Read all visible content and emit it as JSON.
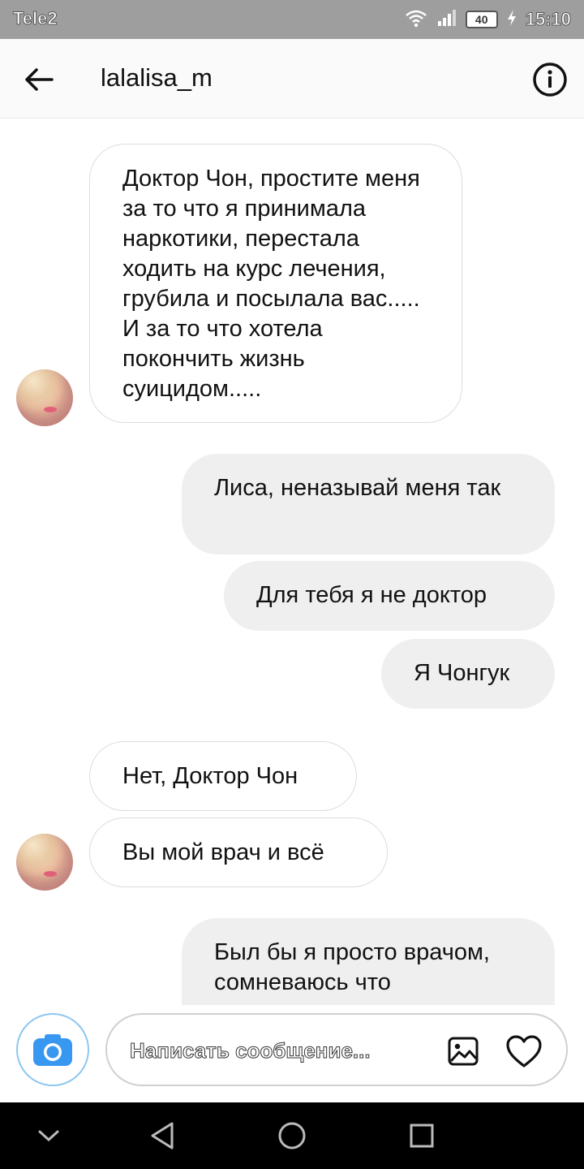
{
  "status_bar": {
    "carrier": "Tele2",
    "battery": "40",
    "time": "15:10",
    "icons": [
      "wifi-icon",
      "signal-icon",
      "battery-icon",
      "charging-icon"
    ]
  },
  "header": {
    "username": "lalalisa_m",
    "back_icon": "arrow-left-icon",
    "info_icon": "info-icon"
  },
  "messages": [
    {
      "direction": "incoming",
      "text": "Доктор Чон, простите меня за то что я принимала наркотики, перестала ходить на курс лечения, грубила и посылала вас..... И за то что хотела покончить жизнь суицидом....."
    },
    {
      "direction": "outgoing",
      "text": "Лиса, неназывай меня так"
    },
    {
      "direction": "outgoing",
      "text": "Для тебя я не доктор"
    },
    {
      "direction": "outgoing",
      "text": "Я Чонгук"
    },
    {
      "direction": "incoming",
      "text": "Нет, Доктор Чон"
    },
    {
      "direction": "incoming",
      "text": "Вы мой врач и всё"
    },
    {
      "direction": "outgoing",
      "text": "Был бы я просто врачом, сомневаюсь что"
    }
  ],
  "composer": {
    "placeholder": "Написать сообщение...",
    "camera_icon": "camera-icon",
    "gallery_icon": "image-icon",
    "like_icon": "heart-icon"
  },
  "colors": {
    "status_bar": "#9e9e9e",
    "outgoing_bubble": "#efefef",
    "incoming_border": "#dcdcdc",
    "camera_accent": "#3897f0",
    "nav_bar": "#000000"
  },
  "nav_bar": {
    "icons": [
      "chevron-down-icon",
      "back-triangle-icon",
      "home-circle-icon",
      "recents-square-icon"
    ]
  }
}
